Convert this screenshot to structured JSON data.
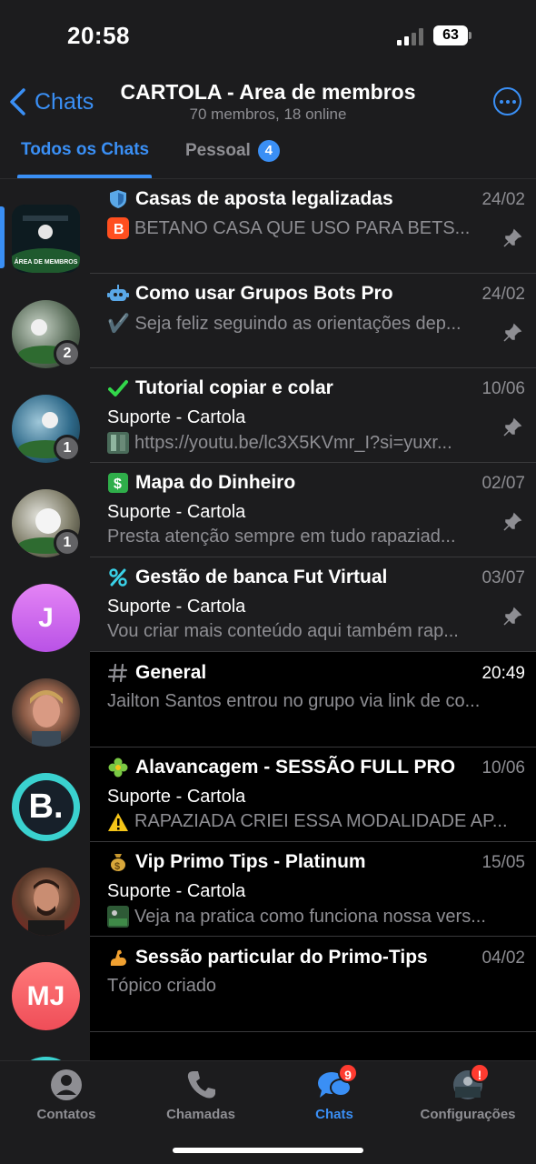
{
  "status": {
    "time": "20:58",
    "battery": "63"
  },
  "header": {
    "back_label": "Chats",
    "title": "CARTOLA - Area de membros",
    "subtitle": "70 membros, 18 online"
  },
  "tabs": [
    {
      "label": "Todos os Chats",
      "active": true
    },
    {
      "label": "Pessoal",
      "badge": "4",
      "active": false
    }
  ],
  "rail": {
    "avatars": [
      {
        "kind": "image",
        "caption": "ÁREA DE MEMBROS"
      },
      {
        "kind": "image",
        "count": "2"
      },
      {
        "kind": "image",
        "count": "1"
      },
      {
        "kind": "image",
        "count": "1"
      },
      {
        "kind": "letter",
        "text": "J",
        "color": "#d46cf0"
      },
      {
        "kind": "photo"
      },
      {
        "kind": "logo",
        "text": "B.",
        "color": "#3ad1cf"
      },
      {
        "kind": "photo"
      },
      {
        "kind": "letter",
        "text": "MJ",
        "color": "#f2575f"
      }
    ]
  },
  "topics": [
    {
      "icon": "shield-icon",
      "title": "Casas de aposta legalizadas",
      "date": "24/02",
      "sender": "",
      "preview_icon": "betano-icon",
      "preview": "BETANO CASA QUE USO PARA BETS...",
      "pinned": true
    },
    {
      "icon": "robot-icon",
      "title": "Como usar Grupos Bots Pro",
      "date": "24/02",
      "sender": "",
      "preview_icon": "check-icon",
      "preview": "✔️ Seja feliz seguindo as orientações dep...",
      "pinned": true
    },
    {
      "icon": "green-check-icon",
      "title": "Tutorial copiar e colar",
      "date": "10/06",
      "sender": "Suporte - Cartola",
      "preview_icon": "video-thumb-icon",
      "preview": "https://youtu.be/lc3X5KVmr_I?si=yuxr...",
      "pinned": true
    },
    {
      "icon": "dollar-icon",
      "title": "Mapa do Dinheiro",
      "date": "02/07",
      "sender": "Suporte - Cartola",
      "preview_icon": "",
      "preview": "Presta atenção sempre em tudo rapaziad...",
      "pinned": true
    },
    {
      "icon": "percent-icon",
      "title": "Gestão de banca Fut Virtual",
      "date": "03/07",
      "sender": "Suporte - Cartola",
      "preview_icon": "",
      "preview": "Vou criar mais conteúdo aqui também rap...",
      "pinned": true
    },
    {
      "icon": "hash-icon",
      "title": "General",
      "date": "20:49",
      "sender": "",
      "preview_icon": "",
      "preview": "Jailton Santos entrou no grupo via link de co...",
      "pinned": false
    },
    {
      "icon": "clover-icon",
      "title": "Alavancagem - SESSÃO FULL PRO",
      "date": "10/06",
      "sender": "Suporte - Cartola",
      "preview_icon": "warning-icon",
      "preview": "RAPAZIADA CRIEI ESSA MODALIDADE AP...",
      "pinned": false
    },
    {
      "icon": "money-bag-icon",
      "title": "Vip Primo Tips - Platinum",
      "date": "15/05",
      "sender": "Suporte - Cartola",
      "preview_icon": "image-thumb-icon",
      "preview": "Veja na pratica como funciona nossa vers...",
      "pinned": false
    },
    {
      "icon": "flexed-arm-icon",
      "title": "Sessão particular do Primo-Tips",
      "date": "04/02",
      "sender": "",
      "preview_icon": "",
      "preview": "Tópico criado",
      "pinned": false
    }
  ],
  "tabbar": [
    {
      "label": "Contatos",
      "icon": "person-icon",
      "active": false
    },
    {
      "label": "Chamadas",
      "icon": "phone-icon",
      "active": false
    },
    {
      "label": "Chats",
      "icon": "chat-bubbles-icon",
      "badge": "9",
      "active": true
    },
    {
      "label": "Configurações",
      "icon": "profile-photo-icon",
      "badge": "!",
      "active": false
    }
  ],
  "colors": {
    "accent": "#3a8ff5",
    "badge_red": "#ff3b30",
    "panel": "#1c1c1e"
  }
}
